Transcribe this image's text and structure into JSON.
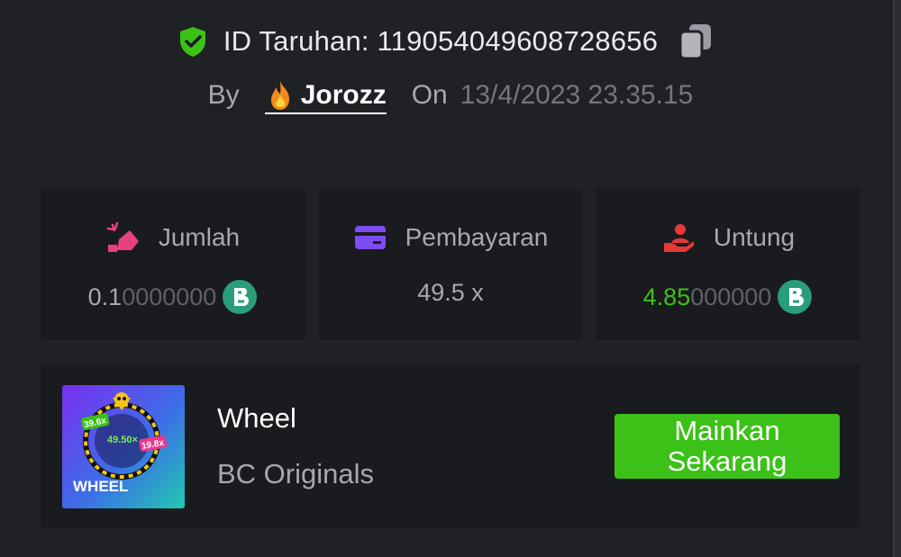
{
  "bet": {
    "id_label": "ID Taruhan: 119054049608728656",
    "by_label": "By",
    "username": "Jorozz",
    "on_label": "On",
    "date": "13/4/2023 23.35.15"
  },
  "stats": [
    {
      "label": "Jumlah",
      "value_strong": "0.1",
      "value_dim": "0000000",
      "icon": "bet-amount-icon"
    },
    {
      "label": "Pembayaran",
      "value": "49.5 x",
      "icon": "payout-card-icon"
    },
    {
      "label": "Untung",
      "value_strong": "4.85",
      "value_dim": "000000",
      "icon": "profit-hand-icon"
    }
  ],
  "game": {
    "title": "Wheel",
    "provider": "BC Originals",
    "play_label": "Mainkan Sekarang",
    "thumb": {
      "brand": "WHEEL",
      "center": "49.50×",
      "left_tag": "39.6x",
      "right_tag": "19.8x"
    }
  },
  "colors": {
    "background": "#202125",
    "card": "#1a1b1e",
    "accent_green": "#3bc117",
    "shield": "#3bc117",
    "text_muted": "#a7a9b0"
  }
}
